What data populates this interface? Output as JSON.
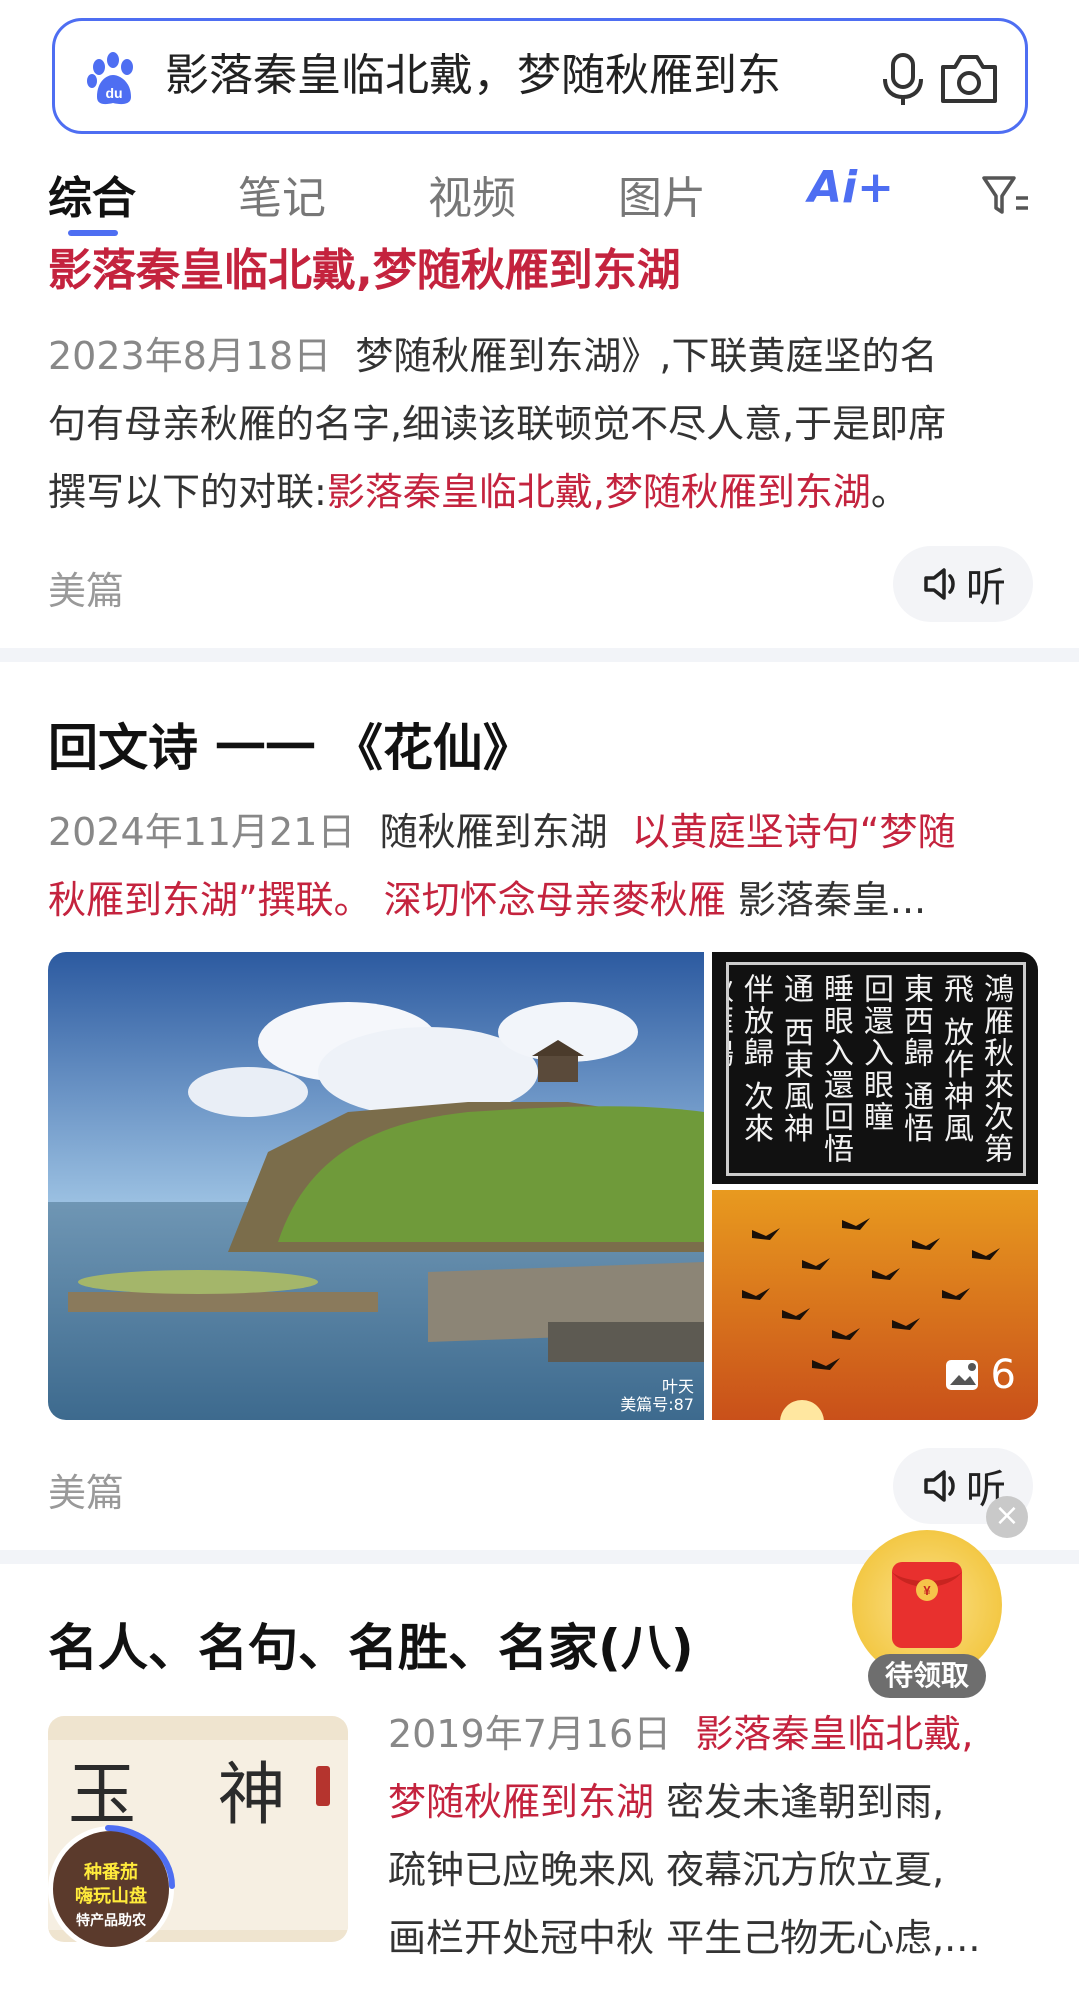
{
  "search": {
    "query": "影落秦皇临北戴，梦随秋雁到东"
  },
  "tabs": [
    {
      "label": "综合"
    },
    {
      "label": "笔记"
    },
    {
      "label": "视频"
    },
    {
      "label": "图片"
    },
    {
      "label": "Ai+"
    }
  ],
  "result1": {
    "title": "影落秦皇临北戴,梦随秋雁到东湖",
    "date": "2023年8月18日",
    "snippet_a": "梦随秋雁到东湖》,下联黄庭坚的名",
    "snippet_b": "句有母亲秋雁的名字,细读该联顿觉不尽人意,于是即席",
    "snippet_c": "撰写以下的对联:",
    "snippet_highlight": "影落秦皇临北戴,梦随秋雁到东湖",
    "snippet_end": "。",
    "source": "美篇",
    "listen_label": "听"
  },
  "result2": {
    "title": "回文诗 一一 《花仙》",
    "date": "2024年11月21日",
    "snippet_a": "随秋雁到东湖",
    "snippet_highlight1": "以黄庭坚诗句“梦随",
    "snippet_highlight2": "秋雁到东湖”撰联。 深切怀念母亲麥秋雁",
    "snippet_b": "影落秦皇...",
    "image_count": "6",
    "watermark1": "叶天",
    "watermark2": "美篇号:87",
    "calligraphy": "鴻雁秋來次第飛 放作神風東西歸 通悟回還入眼瞳 睡眼入還回悟通 西東風神伴放歸 次來秋雁鴻",
    "source": "美篇",
    "listen_label": "听"
  },
  "result3": {
    "title": "名人、名句、名胜、名家(八)",
    "date": "2019年7月16日",
    "highlight1": "影落秦皇临北戴,",
    "highlight2": "梦随秋雁到东湖",
    "text_a": "密发未逢朝到雨,",
    "text_b": "疏钟已应晚来风 夜幕沉方欣立夏,",
    "text_c": "画栏开处冠中秋 平生己物无心虑,...",
    "thumb_chars": "玉 神 山",
    "avatar_text1": "种番茄",
    "avatar_text2": "嗨玩山盘",
    "avatar_text3": "特产品助农"
  },
  "redpacket": {
    "label": "待领取",
    "close": "×"
  },
  "colors": {
    "accent": "#4e6ef2",
    "highlight_red": "#c4233e",
    "muted": "#999999"
  }
}
